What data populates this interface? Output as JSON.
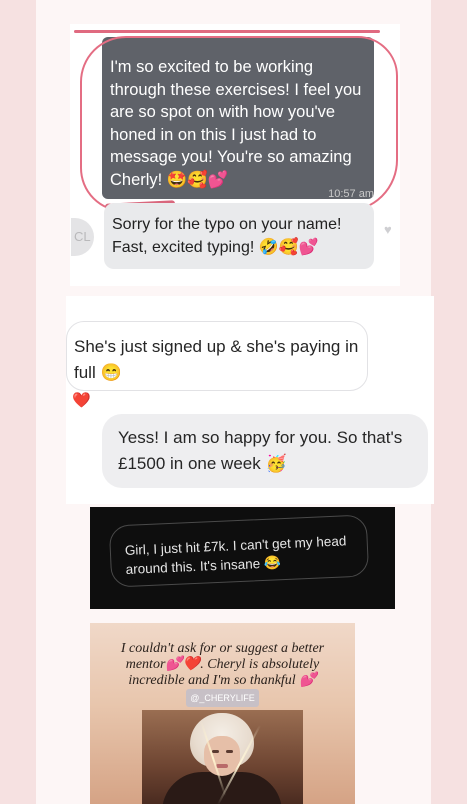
{
  "card1": {
    "message_text": "I'm so excited to be working through these exercises! I feel you are so spot on with how you've honed in on this I just had to message you! You're so amazing Cherly! 🤩🥰💕",
    "timestamp": "10:57 am",
    "avatar_initials": "CL",
    "reply_text": "Sorry for the typo on your name! Fast, excited typing! 🤣🥰💕",
    "heart_icon": "heart-outline-icon"
  },
  "card2": {
    "incoming_text": "She's just signed up & she's paying in full 😁",
    "reaction": "❤️",
    "outgoing_text": "Yess! I am so happy for you. So that's £1500 in one week 🥳"
  },
  "card3": {
    "message_text": "Girl, I just hit £7k. I can't get my head around this. It's insane 😂"
  },
  "card4": {
    "quote_line1": "I couldn't ask for or suggest a better mentor💕❤️. Cheryl is absolutely incredible and I'm so thankful 💕",
    "handle": "@_CHERYLIFE"
  },
  "colors": {
    "background": "#f8e6e6",
    "dark_bubble": "#5f6269",
    "highlight_circle": "#e46d83",
    "light_bubble": "#e9eaec",
    "dark_card": "#0e0e0e"
  }
}
